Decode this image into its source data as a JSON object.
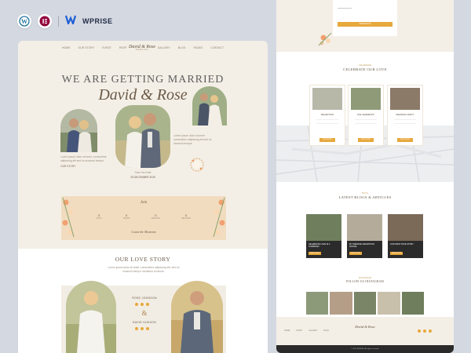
{
  "brand": {
    "name": "WPRISE"
  },
  "left_page": {
    "nav": {
      "left_links": [
        "HOME",
        "OUR STORY",
        "EVENT",
        "RSVP"
      ],
      "logo_name": "David & Rose",
      "logo_sub": "WEDDING",
      "right_links": [
        "GALLERY",
        "BLOG",
        "PAGES",
        "CONTACT"
      ]
    },
    "hero": {
      "title": "WE ARE GETTING MARRIED",
      "names": "David & Rose",
      "left_text": "Lorem ipsum dolor sit amet, consectetur adipiscing elit sed do eiusmod tempor.",
      "left_link": "OUR STORY",
      "right_text": "Lorem ipsum dolor sit amet consectetur adipiscing elit sed do eiusmod tempor.",
      "center_label": "Save the Date",
      "date": "25 DECEMBER 2025"
    },
    "countdown": {
      "title": "Join",
      "values": [
        "0",
        "0",
        "0",
        "0"
      ],
      "units": [
        "DAYS",
        "HOURS",
        "MINUTES",
        "SECONDS"
      ],
      "footer": "Count the Moments"
    },
    "story": {
      "title": "OUR LOVE STORY",
      "text": "Lorem ipsum dolor sit amet, consectetur adipiscing elit, sed do eiusmod tempor incididunt ut labore.",
      "bride_name": "ROSE JOHNSON",
      "groom_name": "DAVID HUDSON",
      "amp": "&"
    }
  },
  "right_page": {
    "rsvp_button": "SEND RSVP",
    "celebrate": {
      "label": "CELEBRATE",
      "title": "CELEBRATE OUR LOVE"
    },
    "events": [
      {
        "title": "RECEPTION",
        "button": "SEE MORE"
      },
      {
        "title": "THE CEREMONY",
        "button": "SEE MORE"
      },
      {
        "title": "WEDDING PARTY",
        "button": "SEE MORE"
      }
    ],
    "blog": {
      "label": "BLOG",
      "title": "LATEST BLOGS & ARTICLES"
    },
    "blog_posts": [
      {
        "title": "CELEBRATE LOVE IN A CHARMING",
        "button": "READ MORE"
      },
      {
        "title": "MY WEDDING RECEPTION ADVICE",
        "button": "READ MORE"
      },
      {
        "title": "OUR FIRST DATE STORY",
        "button": "READ MORE"
      }
    ],
    "instagram": {
      "label": "INSTAGRAM",
      "title": "FOLLOW US INSTAGRAM"
    },
    "footer": {
      "logo": "David & Rose",
      "links": [
        "HOME",
        "STORY",
        "GALLERY",
        "BLOG"
      ],
      "copyright": "© 2024 WPRISE. All rights reserved."
    }
  }
}
